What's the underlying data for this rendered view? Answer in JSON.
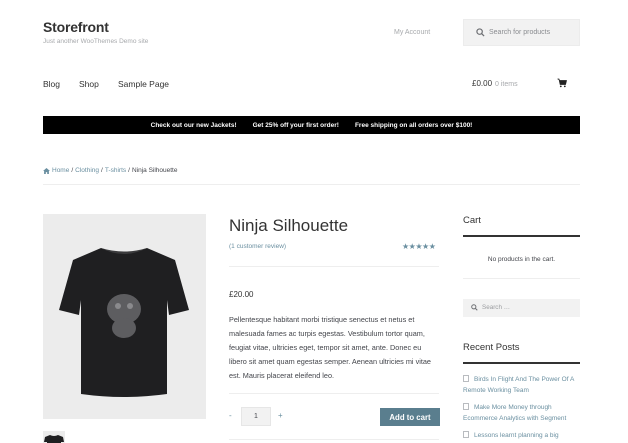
{
  "header": {
    "site_title": "Storefront",
    "tagline": "Just another WooThemes Demo site",
    "my_account": "My Account",
    "search_placeholder": "Search for products"
  },
  "nav": {
    "items": [
      "Blog",
      "Shop",
      "Sample Page"
    ],
    "cart_total": "£0.00",
    "cart_count": "0 items"
  },
  "promo": {
    "messages": [
      "Check out our new Jackets!",
      "Get 25% off your first order!",
      "Free shipping on all orders over $100!"
    ]
  },
  "breadcrumb": {
    "items": [
      "Home",
      "Clothing",
      "T-shirts",
      "Ninja Silhouette"
    ],
    "separator": "/"
  },
  "product": {
    "title": "Ninja Silhouette",
    "review_link": "(1 customer review)",
    "rating": 5,
    "rating_stars": "★★★★★",
    "price": "£20.00",
    "description": "Pellentesque habitant morbi tristique senectus et netus et malesuada fames ac turpis egestas. Vestibulum tortor quam, feugiat vitae, ultricies eget, tempor sit amet, ante. Donec eu libero sit amet quam egestas semper. Aenean ultricies mi vitae est. Mauris placerat eleifend leo.",
    "qty_minus": "-",
    "qty_value": "1",
    "qty_plus": "+",
    "add_to_cart": "Add to cart"
  },
  "sidebar": {
    "cart_title": "Cart",
    "cart_empty": "No products in the cart.",
    "search_placeholder": "Search …",
    "recent_posts_title": "Recent Posts",
    "recent_posts": [
      "Birds In Flight And The Power Of A Remote Working Team",
      "Make More Money through Ecommerce Analytics with Segment",
      "Lessons learnt planning a big"
    ]
  },
  "colors": {
    "accent": "#6a8fa0",
    "button": "#5a7e8e",
    "promo_bg": "#000000"
  }
}
